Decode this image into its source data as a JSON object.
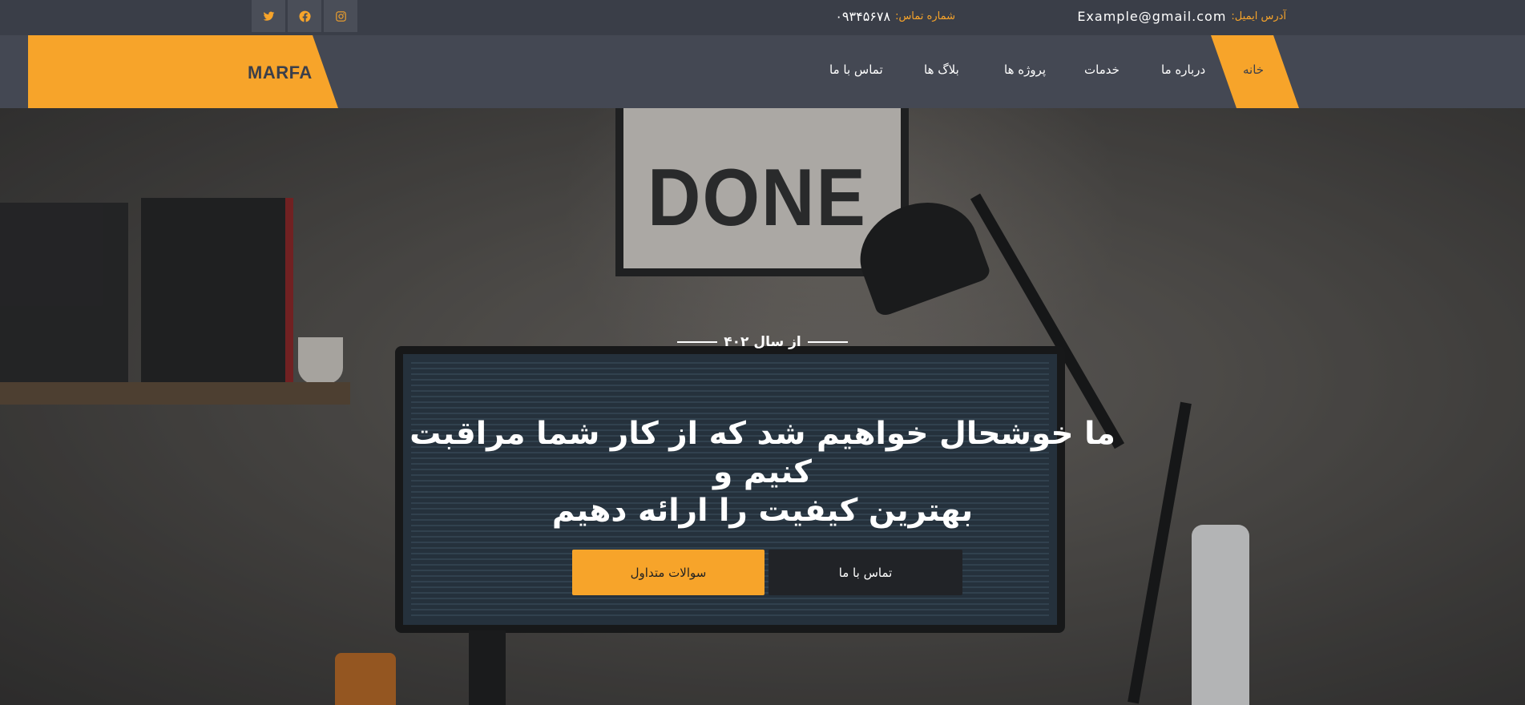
{
  "topbar": {
    "email_label": "آدرس ایمیل:",
    "email_value": "Example@gmail.com",
    "phone_label": "شماره تماس:",
    "phone_value": "۰۹۳۴۵۶۷۸",
    "social": [
      "twitter-icon",
      "facebook-icon",
      "instagram-icon"
    ]
  },
  "nav": {
    "logo": "MARFA",
    "items": [
      "خانه",
      "درباره ما",
      "خدمات",
      "پروژه ها",
      "بلاگ ها",
      "تماس با ما"
    ],
    "active_index": 0
  },
  "hero": {
    "poster_text": "DONE",
    "since": "از سال ۴۰۲",
    "headline_line1": "ما خوشحال خواهیم شد که از کار شما مراقبت کنیم و",
    "headline_line2": "بهترین کیفیت را ارائه دهیم",
    "contact_button": "تماس با ما",
    "faq_button": "سوالات متداول"
  },
  "colors": {
    "accent": "#f7a42a",
    "topbar_bg": "#3a3e48",
    "navbar_bg": "#444853",
    "dark_button": "#212327"
  }
}
